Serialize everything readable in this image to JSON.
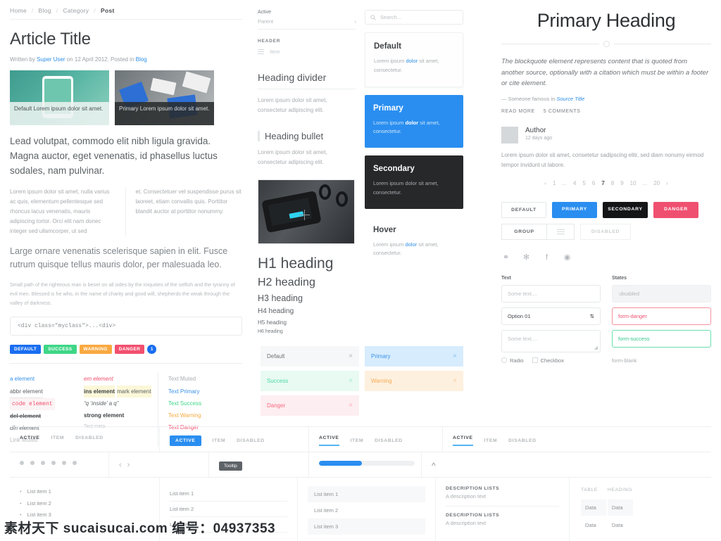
{
  "article": {
    "breadcrumb": [
      "Home",
      "Blog",
      "Category",
      "Post"
    ],
    "title": "Article Title",
    "byline_pre": "Written by ",
    "byline_author": "Super User",
    "byline_mid": " on 12 April 2012. Posted in ",
    "byline_cat": "Blog",
    "thumbs": [
      {
        "caption": "Default Lorem ipsum dolor sit amet."
      },
      {
        "caption": "Primary Lorem ipsum dolor sit amet."
      }
    ],
    "lead": "Lead volutpat, commodo elit nibh ligula gravida. Magna auctor, eget venenatis, id phasellus luctus sodales, nam pulvinar.",
    "col_left": "Lorem ipsum dolor sit amet, nulla varius ac quis, elementum pellentesque sed rhoncus lacus venenatis, mauris adipiscing tortor. Orci elit nam donec integer sed ullamcorper, ut sed",
    "col_right": "et. Consectetuer vel suspendisse purus sit laoreet, etiam convallis quis. Porttitor blandit auctor at porttitor nonummy.",
    "sub_lead": "Large ornare venenatis scelerisque sapien in elit. Fusce rutrum quisque tellus mauris dolor, per malesuada leo.",
    "small_para": "Small path of the righteous man is beset on all sides by the iniquities of the selfish and the tyranny of evil men. Blessed is he who, in the name of charity and good will, shepherds the weak through the valley of darkness.",
    "code": "<div class=\"myclass\">...<div>",
    "badges": [
      {
        "label": "DEFAULT",
        "color": "#1a6ef0"
      },
      {
        "label": "SUCCESS",
        "color": "#3fd687"
      },
      {
        "label": "WARNING",
        "color": "#f9a941"
      },
      {
        "label": "DANGER",
        "color": "#f2506e"
      },
      {
        "label": "1",
        "color": "#1a6ef0"
      }
    ],
    "elements": {
      "col1": [
        {
          "label": "a element",
          "style": "link"
        },
        {
          "label": "abbr element",
          "style": "abbr"
        },
        {
          "label": "code element",
          "style": "code"
        },
        {
          "label": "del element",
          "style": "del"
        },
        {
          "label": "dfn element",
          "style": "dfn"
        },
        {
          "label": "Link Muted",
          "style": "muted"
        }
      ],
      "col2": [
        {
          "label": "em element",
          "style": "em"
        },
        {
          "label": "ins element",
          "style": "ins"
        },
        {
          "label": "mark element",
          "style": "mark"
        },
        {
          "label": "“q ‘inside’ a q”",
          "style": "q"
        },
        {
          "label": "strong element",
          "style": "strong"
        },
        {
          "label": "Text meta",
          "style": "meta"
        }
      ],
      "col3": [
        {
          "label": "Text Muted",
          "style": "muted"
        },
        {
          "label": "Text Primary",
          "style": "primary"
        },
        {
          "label": "Text Success",
          "style": "success"
        },
        {
          "label": "Text Warning",
          "style": "warning"
        },
        {
          "label": "Text Danger",
          "style": "danger"
        }
      ]
    }
  },
  "nav": {
    "active_label": "Active",
    "parent_label": "Parent",
    "header_label": "HEADER",
    "item_label": "Item",
    "heading_divider": "Heading divider",
    "divider_para": "Lorem ipsum dolor sit amet, consectetur adipiscing elit.",
    "heading_bullet": "Heading bullet",
    "bullet_para": "Lorem ipsum dolor sit amet, consectetur adipiscing elit.",
    "headings": {
      "h1": "H1 heading",
      "h2": "H2 heading",
      "h3": "H3 heading",
      "h4": "H4 heading",
      "h5": "H5 heading",
      "h6": "H6 heading"
    }
  },
  "alerts": {
    "left": [
      {
        "label": "Default",
        "close": "×"
      },
      {
        "label": "Success",
        "close": "×"
      },
      {
        "label": "Danger",
        "close": "×"
      }
    ],
    "right": [
      {
        "label": "Primary",
        "close": "×"
      },
      {
        "label": "Warning",
        "close": "×"
      }
    ]
  },
  "cards": {
    "search_placeholder": "Search...",
    "items": [
      {
        "title": "Default",
        "body_pre": "Lorem ipsum ",
        "body_link": "dolor",
        "body_post": " sit amet, consectetur."
      },
      {
        "title": "Primary",
        "body_pre": "Lorem ipsum ",
        "body_link": "dolor",
        "body_post": " sit amet, consectetur."
      },
      {
        "title": "Secondary",
        "body_pre": "Lorem ipsum dolor sit amet, consectetur.",
        "body_link": "",
        "body_post": ""
      },
      {
        "title": "Hover",
        "body_pre": "Lorem ipsum ",
        "body_link": "dolor",
        "body_post": " sit amet, consectetur."
      }
    ]
  },
  "right": {
    "heading": "Primary Heading",
    "blockquote": "The blockquote element represents content that is quoted from another source, optionally with a citation which must be within a footer or cite element.",
    "cite_pre": "— Someone famous in ",
    "cite_link": "Source Title",
    "meta": [
      "READ MORE",
      "5 COMMENTS"
    ],
    "comment": {
      "author": "Author",
      "ago": "12 days ago",
      "text": "Lorem ipsum dolor sit amet, consetetur sadipscing elitr, sed diam nonumy eirmod tempor invidunt ut labore."
    },
    "pagination": {
      "prev": "‹",
      "items": [
        "1",
        "...",
        "4",
        "5",
        "6",
        "7",
        "8",
        "9",
        "10",
        "...",
        "20"
      ],
      "active": "7",
      "next": "›"
    },
    "buttons": [
      "DEFAULT",
      "PRIMARY",
      "SECONDARY",
      "DANGER"
    ],
    "button_group": {
      "label": "GROUP",
      "icon": "list-icon",
      "disabled": "DISABLED"
    },
    "socials": [
      "github-icon",
      "twitter-icon",
      "facebook-icon",
      "dribbble-icon"
    ],
    "forms": {
      "text_label": "Text",
      "states_label": "States",
      "text_placeholder": "Some text....",
      "select_value": "Option 01",
      "textarea_placeholder": "Some text....",
      "radio_label": "Radio",
      "checkbox_label": "Checkbox",
      "disabled_value": ":disabled",
      "danger_value": "form-danger",
      "success_value": "form-success",
      "blank_value": "form-blank"
    }
  },
  "bottom": {
    "tabsets": [
      {
        "items": [
          "ACTIVE",
          "ITEM",
          "DISABLED"
        ],
        "style": "plain"
      },
      {
        "items": [
          "ACTIVE",
          "ITEM",
          "DISABLED"
        ],
        "style": "pill"
      },
      {
        "items": [
          "ACTIVE",
          "ITEM",
          "DISABLED"
        ],
        "style": "underline"
      },
      {
        "items": [
          "ACTIVE",
          "ITEM",
          "DISABLED"
        ],
        "style": "underline"
      }
    ],
    "dots_count": 6,
    "arrow_prev": "‹",
    "arrow_next": "›",
    "tooltip": "Tooltip",
    "progress_percent": 45,
    "collapse_icon": "chevron-up-icon",
    "bullet_list": [
      "List item 1",
      "List item 2",
      "List item 3"
    ],
    "divided_list": [
      "List item 1",
      "List item 2",
      "List item 3"
    ],
    "striped_list": [
      "List item 1",
      "List item 2",
      "List item 3"
    ],
    "description_lists": [
      {
        "term": "DESCRIPTION LISTS",
        "desc": "A description text"
      },
      {
        "term": "DESCRIPTION LISTS",
        "desc": "A description text"
      }
    ],
    "table": {
      "headers": [
        "TABLE",
        "HEADING"
      ],
      "rows": [
        [
          "Data",
          "Data"
        ],
        [
          "Data",
          "Data"
        ]
      ]
    }
  },
  "watermark": "素材天下 sucaisucai.com 编号：04937353"
}
